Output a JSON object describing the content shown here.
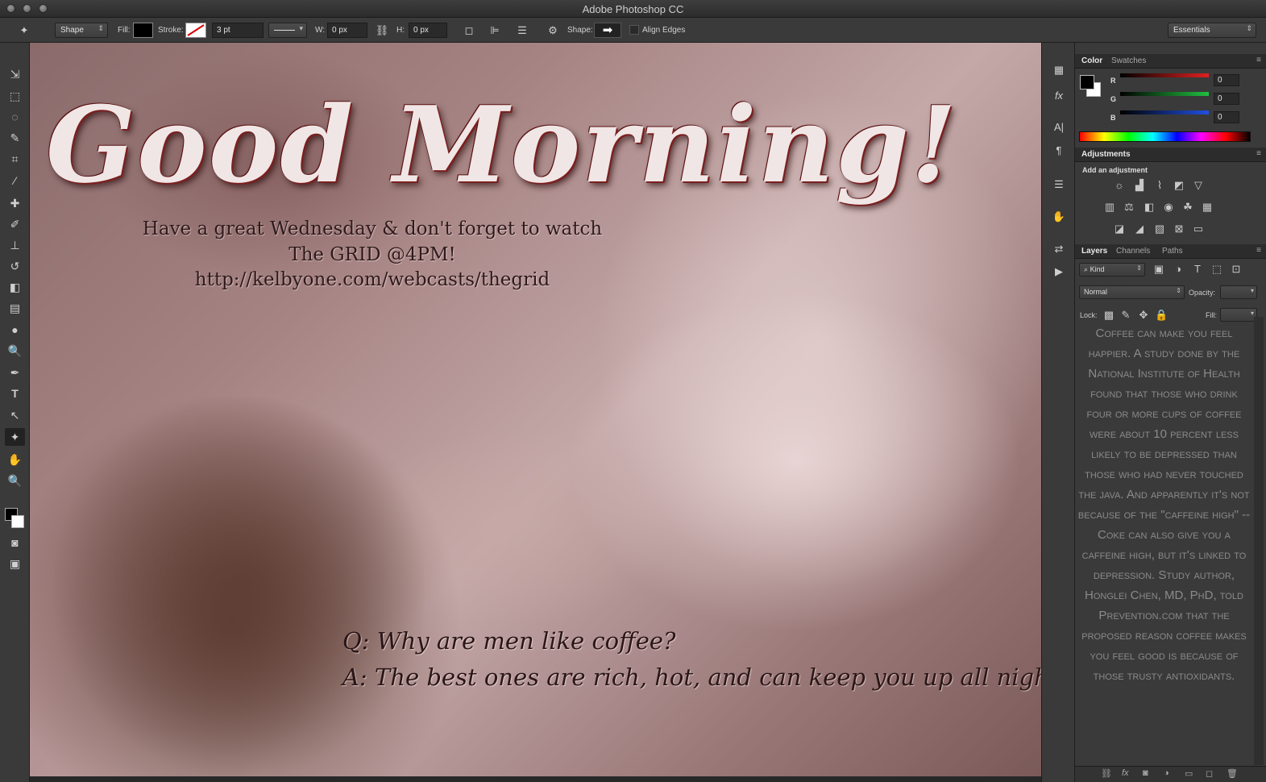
{
  "window": {
    "title": "Adobe Photoshop CC"
  },
  "options_bar": {
    "tool_mode": "Shape",
    "fill_label": "Fill:",
    "stroke_label": "Stroke:",
    "stroke_width": "3 pt",
    "w_label": "W:",
    "w_value": "0 px",
    "h_label": "H:",
    "h_value": "0 px",
    "shape_label": "Shape:",
    "align_edges_label": "Align Edges",
    "workspace": "Essentials"
  },
  "canvas": {
    "headline": "Good Morning!",
    "subtext": [
      "Have a great Wednesday & don't forget to watch",
      "The GRID @4PM!",
      "http://kelbyone.com/webcasts/thegrid"
    ],
    "joke_q": "Q: Why are men like coffee?",
    "joke_a": "A: The best ones are rich, hot, and can keep you up all night!"
  },
  "color_panel": {
    "tabs": [
      "Color",
      "Swatches"
    ],
    "channels": [
      {
        "label": "R",
        "value": "0",
        "color": "#e02020"
      },
      {
        "label": "G",
        "value": "0",
        "color": "#20c040"
      },
      {
        "label": "B",
        "value": "0",
        "color": "#2050e0"
      }
    ]
  },
  "adjustments_panel": {
    "tab": "Adjustments",
    "heading": "Add an adjustment"
  },
  "layers_panel": {
    "tabs": [
      "Layers",
      "Channels",
      "Paths"
    ],
    "filter_kind": "Kind",
    "blend_mode": "Normal",
    "opacity_label": "Opacity:",
    "lock_label": "Lock:",
    "fill_label": "Fill:",
    "text_content": "Coffee can make you feel happier. A study done by the National Institute of Health found that those who drink four or more cups of coffee were about 10 percent less likely to be depressed than those who had never touched the java. And apparently it's not because of the \"caffeine high\" -- Coke can also give you a caffeine high, but it's linked to depression. Study author, Honglei Chen, MD, PhD, told Prevention.com that the proposed reason coffee makes you feel good is because of those trusty antioxidants."
  }
}
